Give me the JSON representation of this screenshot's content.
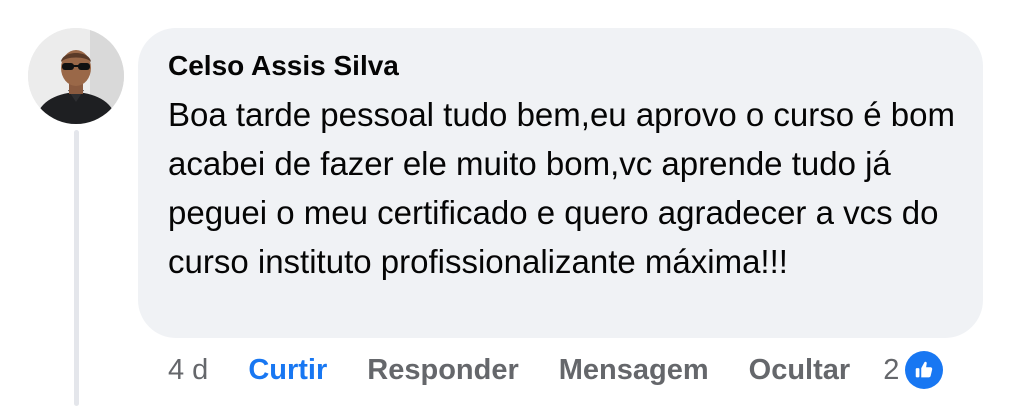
{
  "comment": {
    "author": "Celso Assis Silva",
    "text": "Boa tarde pessoal tudo bem,eu aprovo o curso é bom acabei de fazer ele muito bom,vc aprende tudo já peguei o meu certificado e quero agradecer a vcs do curso instituto profissionalizante máxima!!!",
    "timestamp": "4 d",
    "reaction_count": "2",
    "reaction_icon": "thumbs-up-icon"
  },
  "actions": {
    "like": "Curtir",
    "reply": "Responder",
    "message": "Mensagem",
    "hide": "Ocultar"
  },
  "colors": {
    "accent": "#1877f2",
    "bubble_bg": "#f0f2f5",
    "muted_text": "#65676b"
  }
}
